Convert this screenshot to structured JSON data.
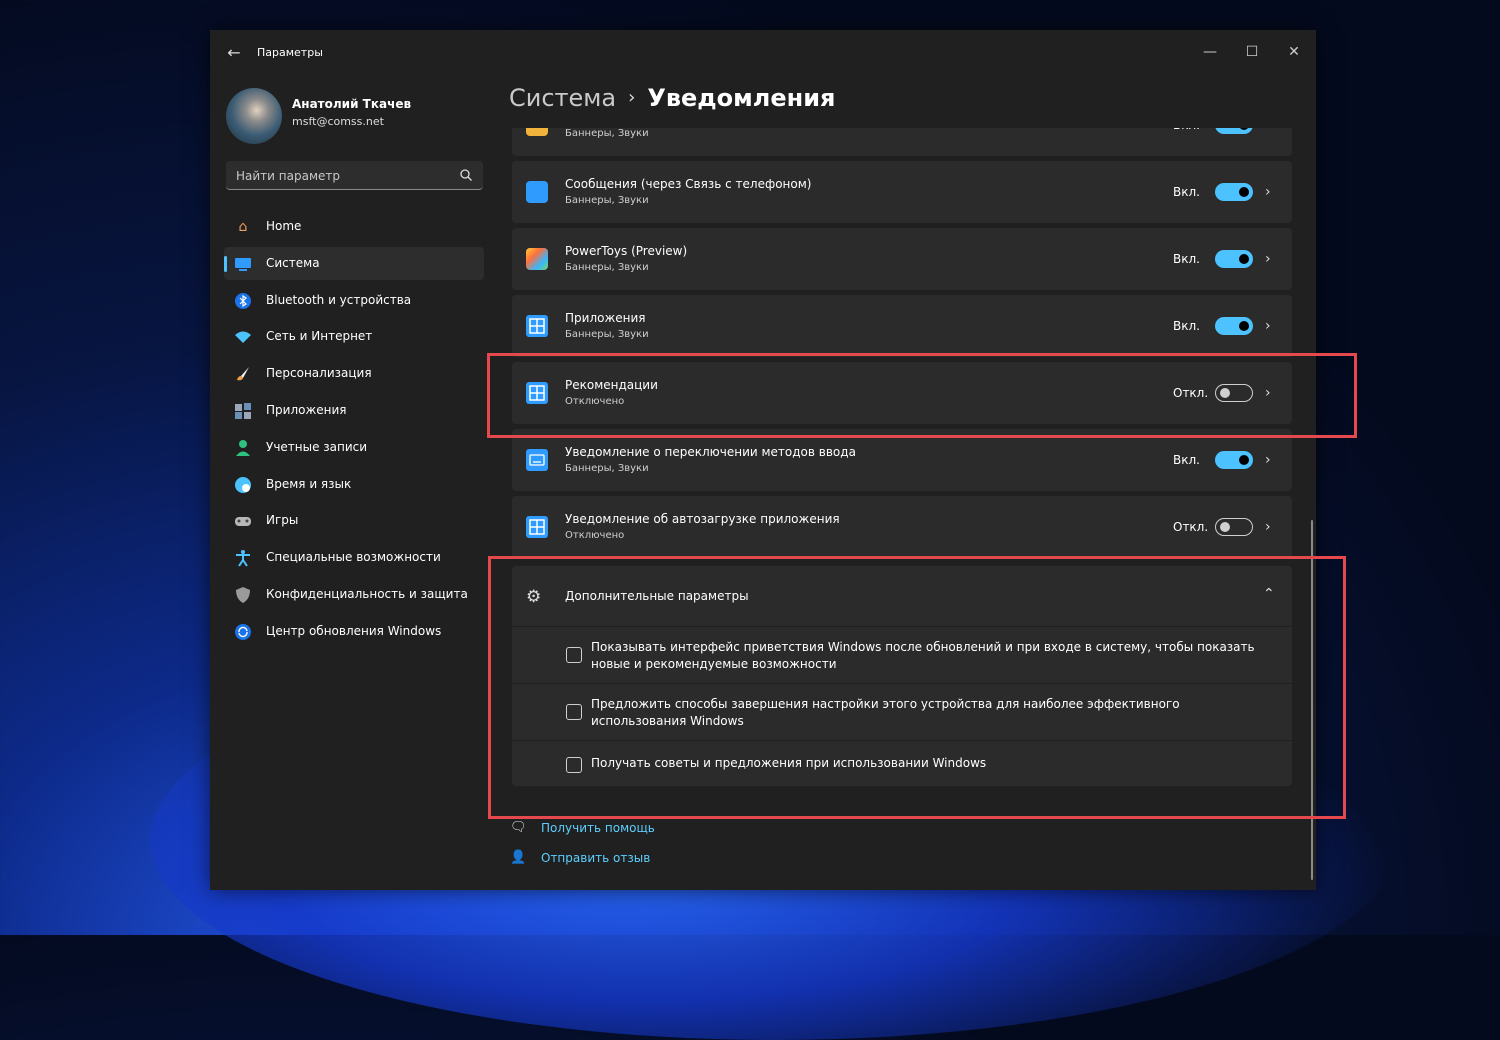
{
  "window": {
    "app_title": "Параметры",
    "minimize_icon": "minimize-icon",
    "maximize_icon": "maximize-icon",
    "close_icon": "close-icon"
  },
  "profile": {
    "name": "Анатолий Ткачев",
    "email": "msft@comss.net"
  },
  "search": {
    "placeholder": "Найти параметр"
  },
  "sidebar": {
    "items": [
      {
        "label": "Home",
        "icon": "home-icon",
        "active": false
      },
      {
        "label": "Система",
        "icon": "monitor-icon",
        "active": true
      },
      {
        "label": "Bluetooth и устройства",
        "icon": "bluetooth-icon",
        "active": false
      },
      {
        "label": "Сеть и Интернет",
        "icon": "wifi-icon",
        "active": false
      },
      {
        "label": "Персонализация",
        "icon": "brush-icon",
        "active": false
      },
      {
        "label": "Приложения",
        "icon": "apps-icon",
        "active": false
      },
      {
        "label": "Учетные записи",
        "icon": "user-icon",
        "active": false
      },
      {
        "label": "Время и язык",
        "icon": "clock-globe-icon",
        "active": false
      },
      {
        "label": "Игры",
        "icon": "gamepad-icon",
        "active": false
      },
      {
        "label": "Специальные возможности",
        "icon": "accessibility-icon",
        "active": false
      },
      {
        "label": "Конфиденциальность и защита",
        "icon": "shield-icon",
        "active": false
      },
      {
        "label": "Центр обновления Windows",
        "icon": "update-icon",
        "active": false
      }
    ]
  },
  "breadcrumb": {
    "parent": "Система",
    "separator": "›",
    "current": "Уведомления"
  },
  "notifications": [
    {
      "title": "",
      "subtitle": "Баннеры, Звуки",
      "state": "Вкл.",
      "on": true
    },
    {
      "title": "Сообщения (через Связь с телефоном)",
      "subtitle": "Баннеры, Звуки",
      "state": "Вкл.",
      "on": true
    },
    {
      "title": "PowerToys (Preview)",
      "subtitle": "Баннеры, Звуки",
      "state": "Вкл.",
      "on": true
    },
    {
      "title": "Приложения",
      "subtitle": "Баннеры, Звуки",
      "state": "Вкл.",
      "on": true
    },
    {
      "title": "Рекомендации",
      "subtitle": "Отключено",
      "state": "Откл.",
      "on": false
    },
    {
      "title": "Уведомление о переключении методов ввода",
      "subtitle": "Баннеры, Звуки",
      "state": "Вкл.",
      "on": true
    },
    {
      "title": "Уведомление об автозагрузке приложения",
      "subtitle": "Отключено",
      "state": "Откл.",
      "on": false
    }
  ],
  "advanced": {
    "title": "Дополнительные параметры",
    "options": [
      {
        "label": "Показывать интерфейс приветствия Windows после обновлений и при входе в систему, чтобы показать новые и рекомендуемые возможности",
        "checked": false
      },
      {
        "label": "Предложить способы завершения настройки этого устройства для наиболее эффективного использования Windows",
        "checked": false
      },
      {
        "label": "Получать советы и предложения при использовании Windows",
        "checked": false
      }
    ]
  },
  "help": {
    "get_help": "Получить помощь",
    "feedback": "Отправить отзыв"
  },
  "colors": {
    "accent": "#4cc2ff",
    "highlight": "#e5484d",
    "window_bg": "#202020",
    "card_bg": "#2b2b2b"
  }
}
